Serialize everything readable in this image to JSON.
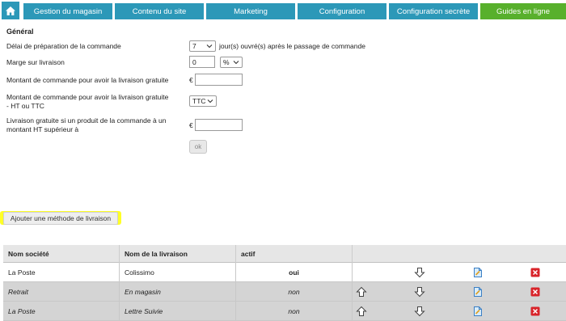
{
  "nav": {
    "home_icon": "home-icon",
    "tabs": [
      {
        "label": "Gestion du magasin"
      },
      {
        "label": "Contenu du site"
      },
      {
        "label": "Marketing"
      },
      {
        "label": "Configuration"
      },
      {
        "label": "Configuration secrète"
      },
      {
        "label": "Guides en ligne"
      }
    ],
    "colors": {
      "tab": "#2c98b8",
      "active_green": "#58b02c"
    }
  },
  "form": {
    "section_title": "Général",
    "delay": {
      "label": "Délai de préparation de la commande",
      "value": "7",
      "suffix": "jour(s) ouvré(s) après le passage de commande"
    },
    "margin": {
      "label": "Marge sur livraison",
      "value": "0",
      "unit": "%"
    },
    "free_amount": {
      "label": "Montant de commande pour avoir la livraison gratuite",
      "currency": "€",
      "value": ""
    },
    "free_mode": {
      "label_line1": "Montant de commande pour avoir la livraison gratuite",
      "label_line2": "- HT ou TTC",
      "value": "TTC"
    },
    "free_product": {
      "label_line1": "Livraison gratuite si un produit de la commande à un",
      "label_line2": "montant HT supérieur à",
      "currency": "€",
      "value": ""
    },
    "ok_label": "ok"
  },
  "add_method_label": "Ajouter une méthode de livraison",
  "table": {
    "headers": [
      "Nom société",
      "Nom de la livraison",
      "actif"
    ],
    "rows": [
      {
        "company": "La Poste",
        "name": "Colissimo",
        "active": "oui"
      },
      {
        "company": "Retrait",
        "name": "En magasin",
        "active": "non"
      },
      {
        "company": "La Poste",
        "name": "Lettre Suivie",
        "active": "non"
      }
    ]
  }
}
